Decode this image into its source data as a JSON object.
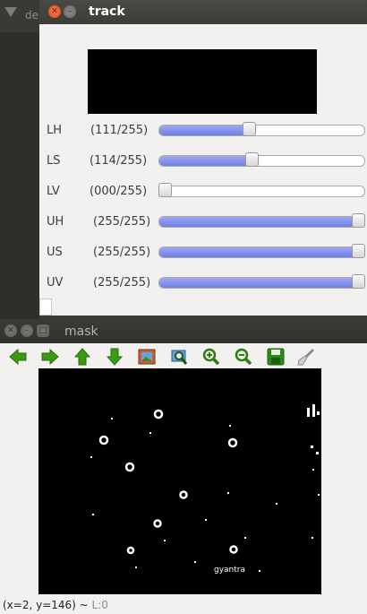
{
  "background_window": {
    "title_fragment": "de"
  },
  "track_window": {
    "title": "track",
    "trackbars": [
      {
        "name": "LH",
        "value_text": "(111/255)",
        "value": 111,
        "max": 255
      },
      {
        "name": "LS",
        "value_text": "(114/255)",
        "value": 114,
        "max": 255
      },
      {
        "name": "LV",
        "value_text": "(000/255)",
        "value": 0,
        "max": 255
      },
      {
        "name": "UH",
        "value_text": "(255/255)",
        "value": 255,
        "max": 255
      },
      {
        "name": "US",
        "value_text": "(255/255)",
        "value": 255,
        "max": 255
      },
      {
        "name": "UV",
        "value_text": "(255/255)",
        "value": 255,
        "max": 255
      }
    ]
  },
  "mask_window": {
    "title": "mask",
    "image_watermark": "gyantra",
    "status": {
      "coords": "(x=2, y=146) ~",
      "level": "L:0"
    }
  },
  "toolbar_icons": [
    "arrow-left-icon",
    "arrow-right-icon",
    "arrow-up-icon",
    "arrow-down-icon",
    "image-icon",
    "zoom-fit-icon",
    "zoom-in-icon",
    "zoom-out-icon",
    "save-icon",
    "brush-icon"
  ],
  "colors": {
    "slider_fill": "#7d8cec",
    "arrow_green": "#3a9a12",
    "close_orange": "#e85a2a"
  }
}
